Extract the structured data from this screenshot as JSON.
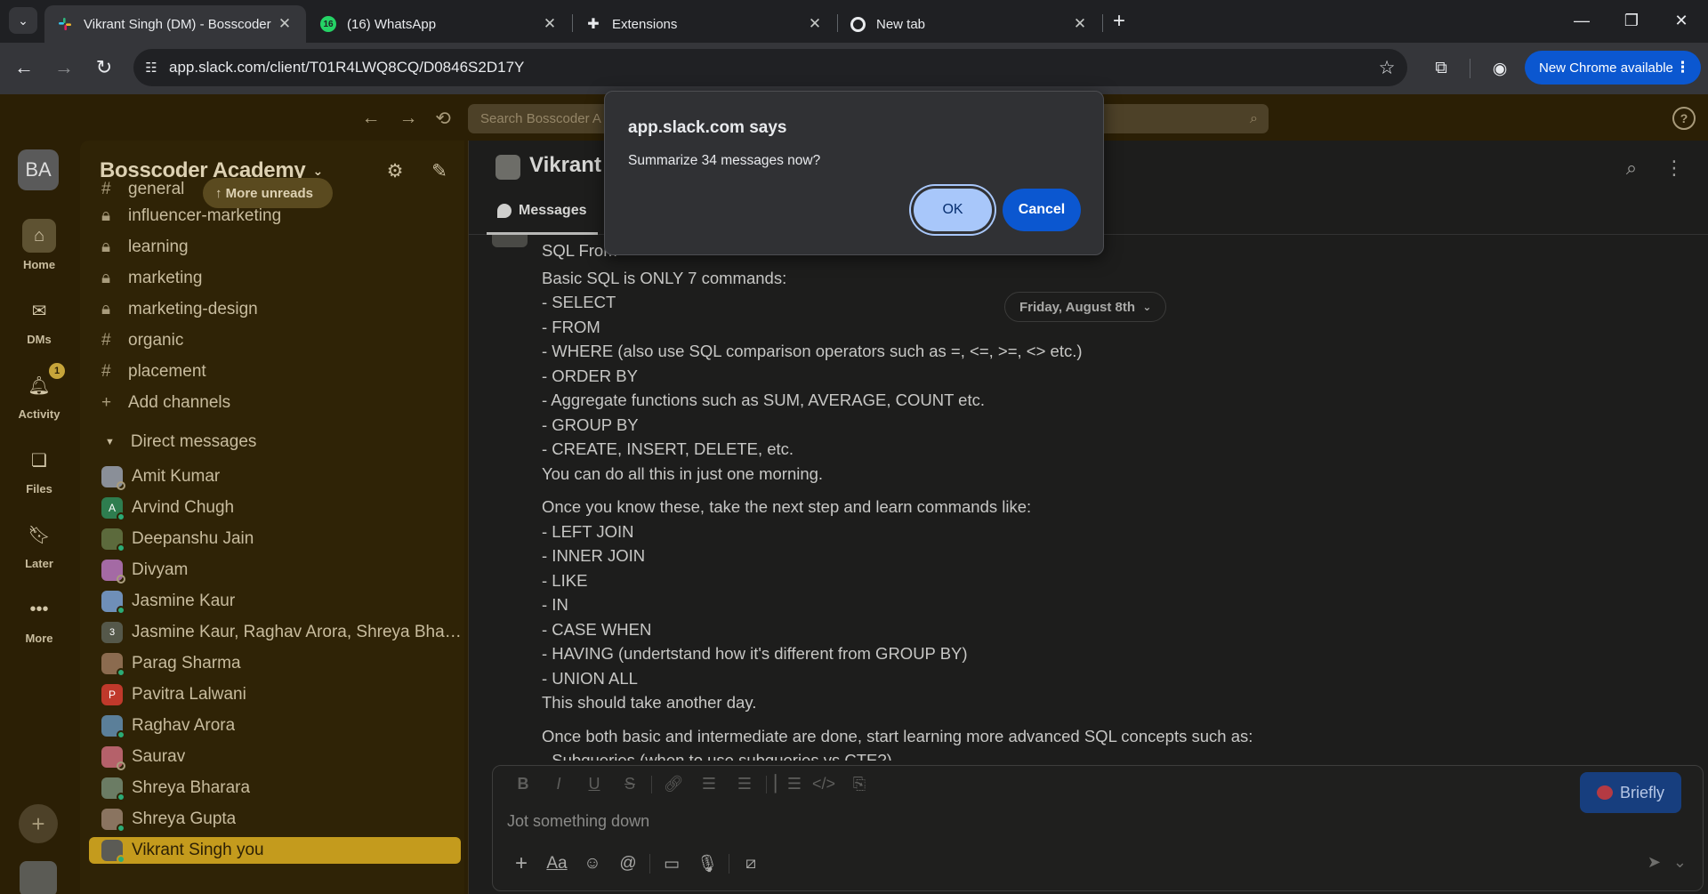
{
  "browser": {
    "tabs": [
      {
        "title": "Vikrant Singh (DM) - Bosscoder",
        "favicon": "slack-icon",
        "active": true
      },
      {
        "title": "(16) WhatsApp",
        "favicon": "whatsapp-icon",
        "badge": "16",
        "active": false
      },
      {
        "title": "Extensions",
        "favicon": "puzzle-icon",
        "active": false
      },
      {
        "title": "New tab",
        "favicon": "chrome-icon",
        "active": false
      }
    ],
    "url": "app.slack.com/client/T01R4LWQ8CQ/D0846S2D17Y",
    "new_chrome_label": "New Chrome available",
    "accent_color": "#0b57d0"
  },
  "slack": {
    "search_placeholder": "Search Bosscoder A",
    "rail": [
      {
        "label": "Home",
        "icon": "home-icon"
      },
      {
        "label": "DMs",
        "icon": "dms-icon"
      },
      {
        "label": "Activity",
        "icon": "bell-icon",
        "badge": "1"
      },
      {
        "label": "Files",
        "icon": "files-icon"
      },
      {
        "label": "Later",
        "icon": "bookmark-icon"
      },
      {
        "label": "More",
        "icon": "more-icon"
      }
    ],
    "workspace_initials": "BA",
    "workspace_name": "Bosscoder Academy",
    "more_unreads": "More unreads",
    "channels": [
      {
        "name": "general",
        "type": "public"
      },
      {
        "name": "influencer-marketing",
        "type": "private"
      },
      {
        "name": "learning",
        "type": "private"
      },
      {
        "name": "marketing",
        "type": "private"
      },
      {
        "name": "marketing-design",
        "type": "private"
      },
      {
        "name": "organic",
        "type": "public"
      },
      {
        "name": "placement",
        "type": "public"
      }
    ],
    "add_channels": "Add channels",
    "direct_messages_label": "Direct messages",
    "dms": [
      {
        "name": "Amit Kumar"
      },
      {
        "name": "Arvind Chugh"
      },
      {
        "name": "Deepanshu Jain"
      },
      {
        "name": "Divyam"
      },
      {
        "name": "Jasmine Kaur"
      },
      {
        "name": "Jasmine Kaur, Raghav Arora, Shreya Bhar...",
        "group_count": "3"
      },
      {
        "name": "Parag Sharma"
      },
      {
        "name": "Pavitra Lalwani",
        "initial": "P"
      },
      {
        "name": "Raghav Arora"
      },
      {
        "name": "Saurav"
      },
      {
        "name": "Shreya Bharara"
      },
      {
        "name": "Shreya Gupta"
      },
      {
        "name": "Vikrant Singh  you",
        "selected": true
      }
    ],
    "conversation": {
      "title": "Vikrant S",
      "tab_messages": "Messages",
      "date_divider": "Friday, August 8th",
      "message_lines": [
        "SQL From",
        "Basic SQL is ONLY 7 commands:",
        "- SELECT",
        "- FROM",
        "- WHERE (also use SQL comparison operators such as =, <=, >=, <> etc.)",
        "- ORDER BY",
        "- Aggregate functions such as SUM, AVERAGE, COUNT etc.",
        "- GROUP BY",
        "- CREATE, INSERT, DELETE, etc.",
        "You can do all this in just one morning.",
        "Once you know these, take the next step and learn commands like:",
        "- LEFT JOIN",
        "- INNER JOIN",
        "- LIKE",
        "- IN",
        "- CASE WHEN",
        "- HAVING (undertstand how it's different from GROUP BY)",
        "- UNION ALL",
        "This should take another day.",
        "Once both basic and intermediate are done, start learning more advanced SQL concepts such as:",
        "- Subqueries (when to use subqueries vs CTE?)"
      ],
      "composer_placeholder": "Jot something down",
      "briefly_label": "Briefly"
    }
  },
  "dialog": {
    "title": "app.slack.com says",
    "message": "Summarize 34 messages now?",
    "ok_label": "OK",
    "cancel_label": "Cancel"
  }
}
